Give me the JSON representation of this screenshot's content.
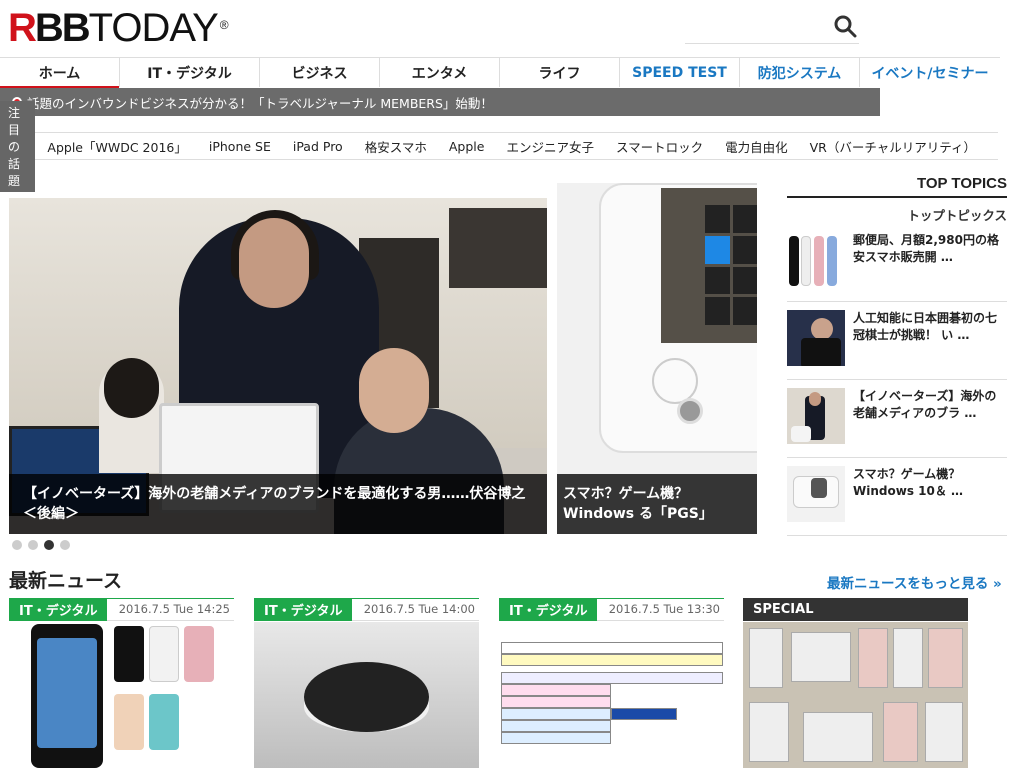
{
  "header": {
    "logo_r": "R",
    "logo_bb": "BB",
    "logo_today": "TODAY",
    "logo_reg": "®"
  },
  "nav": [
    {
      "label": "ホーム",
      "active": true
    },
    {
      "label": "IT・デジタル"
    },
    {
      "label": "ビジネス"
    },
    {
      "label": "エンタメ"
    },
    {
      "label": "ライフ"
    },
    {
      "label": "SPEED TEST",
      "blue": true
    },
    {
      "label": "防犯システム",
      "blue": true
    },
    {
      "label": "イベント/セミナー",
      "blue": true
    }
  ],
  "ticker": {
    "text": "話題のインバウンドビジネスが分かる！「トラベルジャーナル MEMBERS」始動！"
  },
  "topics": {
    "label": "注目の話題",
    "items": [
      "Apple「WWDC 2016」",
      "iPhone SE",
      "iPad Pro",
      "格安スマホ",
      "Apple",
      "エンジニア女子",
      "スマートロック",
      "電力自由化",
      "VR（バーチャルリアリティ）"
    ]
  },
  "hero": {
    "main_caption": "【イノベーターズ】海外の老舗メディアのブランドを最適化する男……伏谷博之＜後編＞",
    "side_caption": "スマホ？ゲーム機？ Windows る「PGS」",
    "slide_count": 4,
    "active_slide": 3
  },
  "sidebar": {
    "title": "TOP TOPICS",
    "subtitle": "トップトピックス",
    "items": [
      {
        "text": "郵便局、月額2,980円の格安スマホ販売開 …"
      },
      {
        "text": "人工知能に日本囲碁初の七冠棋士が挑戦！ い …"
      },
      {
        "text": "【イノベーターズ】海外の老舗メディアのブラ …"
      },
      {
        "text": "スマホ？ゲーム機？ Windows 10＆ …"
      }
    ]
  },
  "news": {
    "heading": "最新ニュース",
    "more": "最新ニュースをもっと見る »",
    "cards": [
      {
        "tag": "IT・デジタル",
        "date": "2016.7.5 Tue 14:25"
      },
      {
        "tag": "IT・デジタル",
        "date": "2016.7.5 Tue 14:00"
      },
      {
        "tag": "IT・デジタル",
        "date": "2016.7.5 Tue 13:30"
      },
      {
        "tag": "SPECIAL",
        "date": ""
      }
    ]
  },
  "colors": {
    "brand_red": "#d0121b",
    "category_green": "#1ea84a",
    "link_blue": "#1a78c2"
  }
}
